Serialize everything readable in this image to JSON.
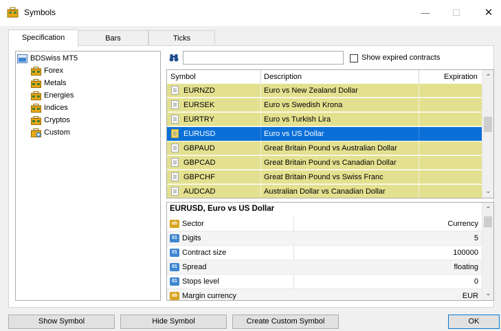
{
  "window": {
    "title": "Symbols",
    "minimize": "—",
    "maximize": "☐",
    "close": "✕"
  },
  "tabs": [
    {
      "label": "Specification",
      "active": true
    },
    {
      "label": "Bars",
      "active": false
    },
    {
      "label": "Ticks",
      "active": false
    }
  ],
  "tree": {
    "root": "BDSwiss MT5",
    "children": [
      {
        "label": "Forex",
        "icon": "folder-icon"
      },
      {
        "label": "Metals",
        "icon": "folder-icon"
      },
      {
        "label": "Energies",
        "icon": "folder-icon"
      },
      {
        "label": "Indices",
        "icon": "folder-icon"
      },
      {
        "label": "Cryptos",
        "icon": "folder-icon"
      },
      {
        "label": "Custom",
        "icon": "custom-folder-icon"
      }
    ]
  },
  "search": {
    "value": "",
    "placeholder": "",
    "show_expired_label": "Show expired contracts",
    "show_expired_checked": false
  },
  "symbol_table": {
    "columns": [
      "Symbol",
      "Description",
      "Expiration"
    ],
    "rows": [
      {
        "symbol": "EURNZD",
        "description": "Euro vs New Zealand Dollar",
        "expiration": "",
        "selected": false
      },
      {
        "symbol": "EURSEK",
        "description": "Euro vs Swedish Krona",
        "expiration": "",
        "selected": false
      },
      {
        "symbol": "EURTRY",
        "description": "Euro vs Turkish Lira",
        "expiration": "",
        "selected": false
      },
      {
        "symbol": "EURUSD",
        "description": "Euro vs US Dollar",
        "expiration": "",
        "selected": true
      },
      {
        "symbol": "GBPAUD",
        "description": "Great Britain Pound vs Australian Dollar",
        "expiration": "",
        "selected": false
      },
      {
        "symbol": "GBPCAD",
        "description": "Great Britain Pound vs Canadian Dollar",
        "expiration": "",
        "selected": false
      },
      {
        "symbol": "GBPCHF",
        "description": "Great Britain Pound vs Swiss Franc",
        "expiration": "",
        "selected": false
      },
      {
        "symbol": "AUDCAD",
        "description": "Australian Dollar vs Canadian Dollar",
        "expiration": "",
        "selected": false
      }
    ]
  },
  "properties": {
    "title": "EURUSD, Euro vs US Dollar",
    "rows": [
      {
        "name": "Sector",
        "value": "Currency",
        "icon": "ab"
      },
      {
        "name": "Digits",
        "value": "5",
        "icon": "num"
      },
      {
        "name": "Contract size",
        "value": "100000",
        "icon": "num"
      },
      {
        "name": "Spread",
        "value": "floating",
        "icon": "num"
      },
      {
        "name": "Stops level",
        "value": "0",
        "icon": "num"
      },
      {
        "name": "Margin currency",
        "value": "EUR",
        "icon": "ab"
      }
    ]
  },
  "buttons": {
    "show_symbol": "Show Symbol",
    "hide_symbol": "Hide Symbol",
    "create_custom": "Create Custom Symbol",
    "ok": "OK"
  },
  "colors": {
    "row_highlight": "#e3e18f",
    "selected": "#0b6fd8"
  }
}
